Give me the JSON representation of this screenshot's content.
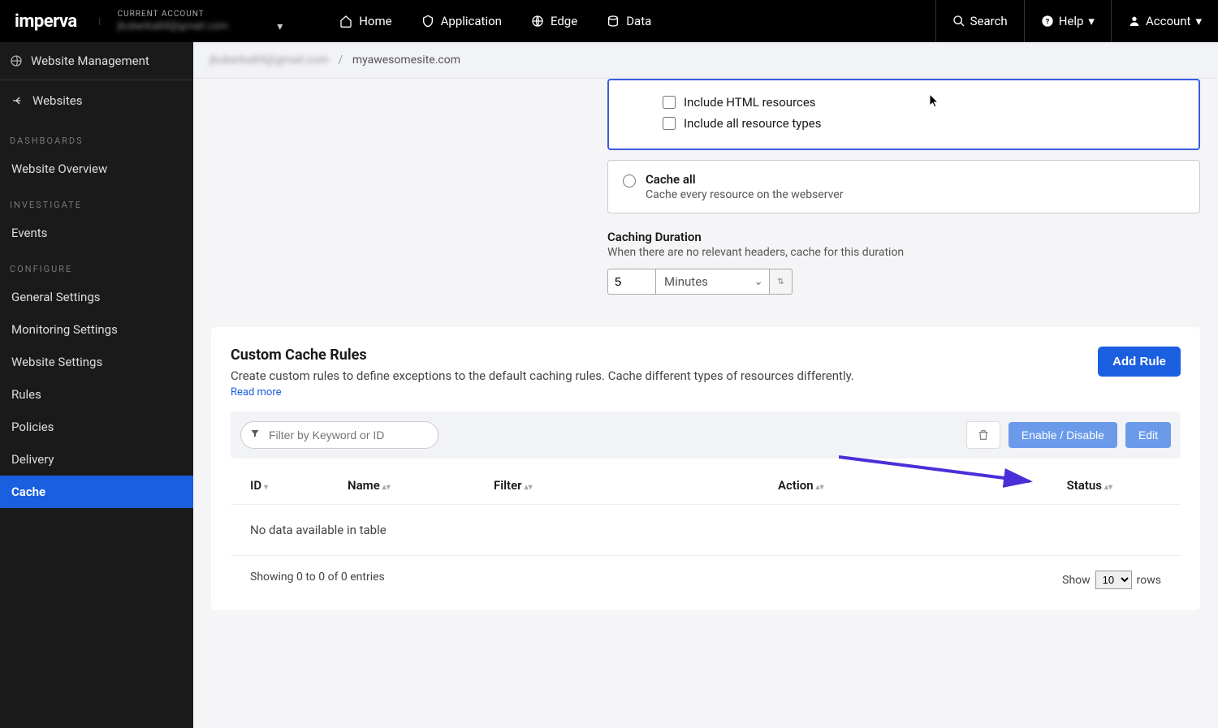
{
  "brand": "imperva",
  "account_selector": {
    "label": "CURRENT ACCOUNT",
    "value": "jkuberka84@gmail.com"
  },
  "topnav": {
    "home": "Home",
    "application": "Application",
    "edge": "Edge",
    "data": "Data",
    "search": "Search",
    "help": "Help",
    "account": "Account"
  },
  "breadcrumb": {
    "account": "jkuberka84@gmail.com",
    "site": "myawesomesite.com"
  },
  "sidebar": {
    "header": "Website Management",
    "back": "Websites",
    "sections": {
      "dashboards": "DASHBOARDS",
      "investigate": "INVESTIGATE",
      "configure": "CONFIGURE"
    },
    "items": {
      "overview": "Website Overview",
      "events": "Events",
      "general": "General Settings",
      "monitoring": "Monitoring Settings",
      "website_settings": "Website Settings",
      "rules": "Rules",
      "policies": "Policies",
      "delivery": "Delivery",
      "cache": "Cache"
    }
  },
  "cache_panel": {
    "check_html": "Include HTML resources",
    "check_all": "Include all resource types",
    "cache_all_title": "Cache all",
    "cache_all_desc": "Cache every resource on the webserver",
    "duration_title": "Caching Duration",
    "duration_desc": "When there are no relevant headers, cache for this duration",
    "duration_value": "5",
    "duration_unit": "Minutes"
  },
  "custom_rules": {
    "title": "Custom Cache Rules",
    "desc": "Create custom rules to define exceptions to the default caching rules. Cache different types of resources differently.",
    "read_more": "Read more",
    "add_rule": "Add Rule",
    "filter_placeholder": "Filter by Keyword or ID",
    "enable_disable": "Enable / Disable",
    "edit": "Edit",
    "columns": {
      "id": "ID",
      "name": "Name",
      "filter": "Filter",
      "action": "Action",
      "status": "Status"
    },
    "empty": "No data available in table",
    "footer_info": "Showing 0 to 0 of 0 entries",
    "show_label": "Show",
    "rows_label": "rows",
    "page_size": "10"
  }
}
